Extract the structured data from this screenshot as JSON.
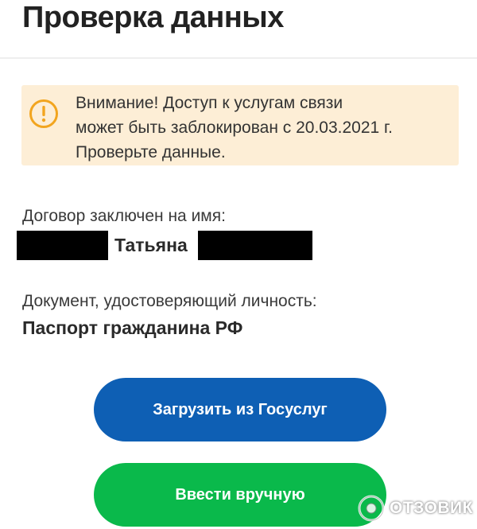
{
  "header": {
    "title": "Проверка данных"
  },
  "alert": {
    "icon": "warning-circle-icon",
    "lines": [
      "Внимание! Доступ к услугам связи",
      "может быть заблокирован с 20.03.2021 г.",
      "Проверьте данные."
    ],
    "color": "#fdeed6",
    "icon_color": "#f2a51f"
  },
  "contract": {
    "label": "Договор заключен на имя:",
    "first_name": "Татьяна"
  },
  "document": {
    "label": "Документ, удостоверяющий личность:",
    "value": "Паспорт гражданина РФ"
  },
  "actions": {
    "gosuslugi_label": "Загрузить из Госуслуг",
    "manual_label": "Ввести вручную",
    "gosuslugi_color": "#0e5fb4",
    "manual_color": "#0ab94b"
  },
  "watermark": {
    "text": "ОТЗОВИК"
  }
}
